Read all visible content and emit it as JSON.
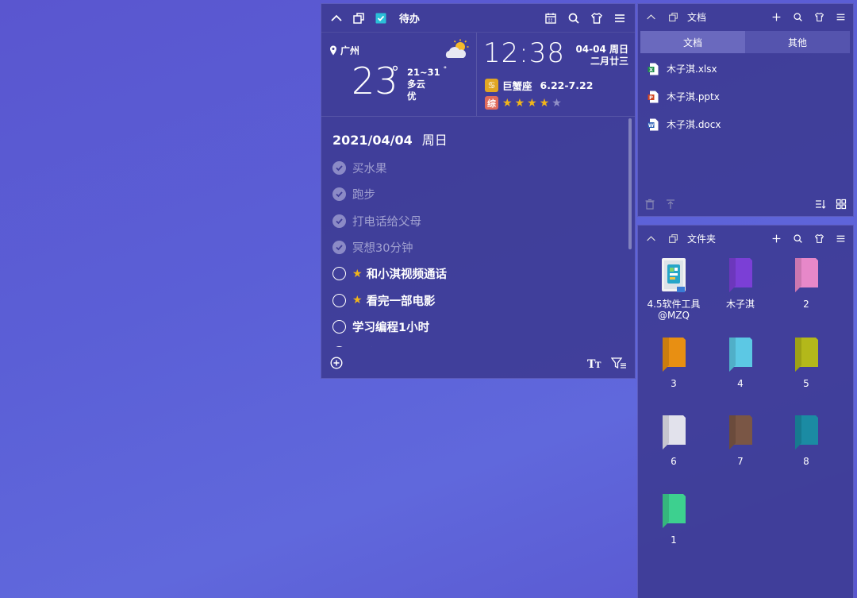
{
  "todo": {
    "title": "待办",
    "weather": {
      "city": "广州",
      "temp": "23",
      "deg": "°",
      "range": "21~31",
      "range_deg": "°",
      "condition": "多云",
      "air": "优"
    },
    "clock": {
      "time": "12:38",
      "date": "04-04 周日",
      "lunar": "二月廿三"
    },
    "zodiac": {
      "icon": "♋",
      "name": "巨蟹座",
      "range": "6.22-7.22",
      "overall_icon": "综",
      "stars": 4,
      "stars_max": 5
    },
    "list_date": "2021/04/04",
    "list_weekday": "周日",
    "tasks": [
      {
        "text": "买水果",
        "done": true,
        "starred": false
      },
      {
        "text": "跑步",
        "done": true,
        "starred": false
      },
      {
        "text": "打电话给父母",
        "done": true,
        "starred": false
      },
      {
        "text": "冥想30分钟",
        "done": true,
        "starred": false
      },
      {
        "text": "和小淇视频通话",
        "done": false,
        "starred": true
      },
      {
        "text": "看完一部电影",
        "done": false,
        "starred": true
      },
      {
        "text": "学习编程1小时",
        "done": false,
        "starred": false
      },
      {
        "text": "学习新技能",
        "done": false,
        "starred": true
      }
    ]
  },
  "docs": {
    "title": "文档",
    "tabs": [
      "文档",
      "其他"
    ],
    "files": [
      {
        "name": "木子淇.xlsx",
        "icon": "excel-icon",
        "color": "#1f8c4d"
      },
      {
        "name": "木子淇.pptx",
        "icon": "powerpoint-icon",
        "color": "#d04423"
      },
      {
        "name": "木子淇.docx",
        "icon": "word-icon",
        "color": "#2b5fb6"
      }
    ]
  },
  "folders": {
    "title": "文件夹",
    "items": [
      {
        "label": "4.5软件工具",
        "label2": "@MZQ",
        "color": "app"
      },
      {
        "label": "木子淇",
        "color": "#7b3fd6"
      },
      {
        "label": "2",
        "color": "#e788c9"
      },
      {
        "label": "3",
        "color": "#e88f12"
      },
      {
        "label": "4",
        "color": "#5cc8e4"
      },
      {
        "label": "5",
        "color": "#b3b81a"
      },
      {
        "label": "6",
        "color": "#e2e2ec"
      },
      {
        "label": "7",
        "color": "#7a5645"
      },
      {
        "label": "8",
        "color": "#1b8ba3"
      },
      {
        "label": "1",
        "color": "#3dd08f"
      }
    ]
  },
  "colors": {
    "accent": "#f1b51a",
    "panel": "#3e3c96"
  }
}
